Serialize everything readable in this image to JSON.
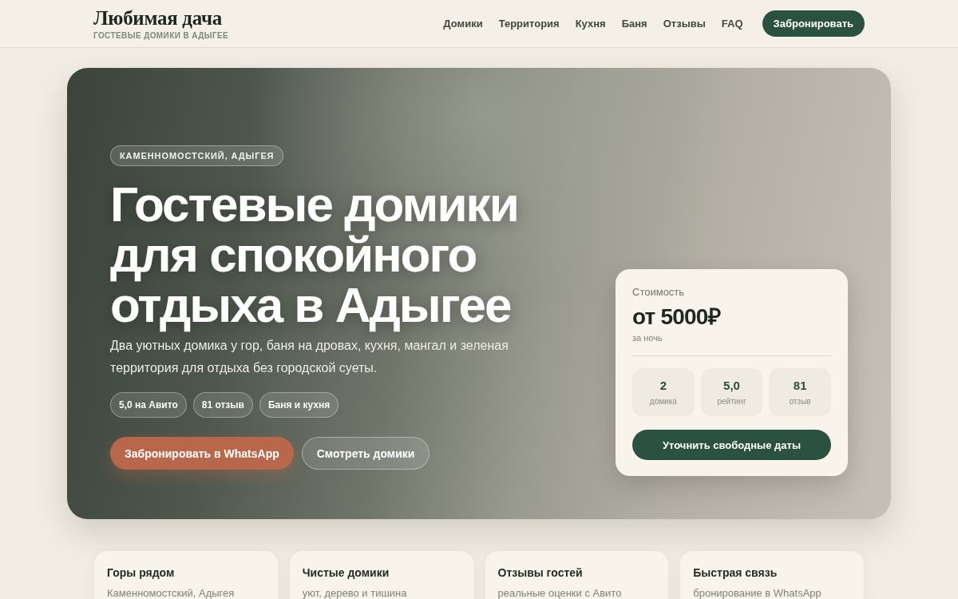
{
  "header": {
    "logo": "Любимая дача",
    "tagline": "ГОСТЕВЫЕ ДОМИКИ В АДЫГЕЕ",
    "nav": [
      "Домики",
      "Территория",
      "Кухня",
      "Баня",
      "Отзывы",
      "FAQ"
    ],
    "cta": "Забронировать"
  },
  "hero": {
    "location": "КАМЕННОМОСТСКИЙ, АДЫГЕЯ",
    "title": "Гостевые домики для спокойного отдыха в Адыгее",
    "description": "Два уютных домика у гор, баня на дровах, кухня, мангал и зеленая территория для отдыха без городской суеты.",
    "chips": [
      "5,0 на Авито",
      "81 отзыв",
      "Баня и кухня"
    ],
    "buttons": [
      {
        "label": "Забронировать в WhatsApp",
        "kind": "primary"
      },
      {
        "label": "Смотреть домики",
        "kind": "secondary"
      }
    ]
  },
  "price_card": {
    "label": "Стоимость",
    "price": "от 5000₽",
    "unit": "за ночь",
    "stats": [
      {
        "value": "2",
        "label": "домика"
      },
      {
        "value": "5,0",
        "label": "рейтинг"
      },
      {
        "value": "81",
        "label": "отзыв"
      }
    ],
    "button": "Уточнить свободные даты"
  },
  "features": [
    {
      "title": "Горы рядом",
      "subtitle": "Каменномостский, Адыгея"
    },
    {
      "title": "Чистые домики",
      "subtitle": "уют, дерево и тишина"
    },
    {
      "title": "Отзывы гостей",
      "subtitle": "реальные оценки с Авито"
    },
    {
      "title": "Быстрая связь",
      "subtitle": "бронирование в WhatsApp"
    }
  ]
}
